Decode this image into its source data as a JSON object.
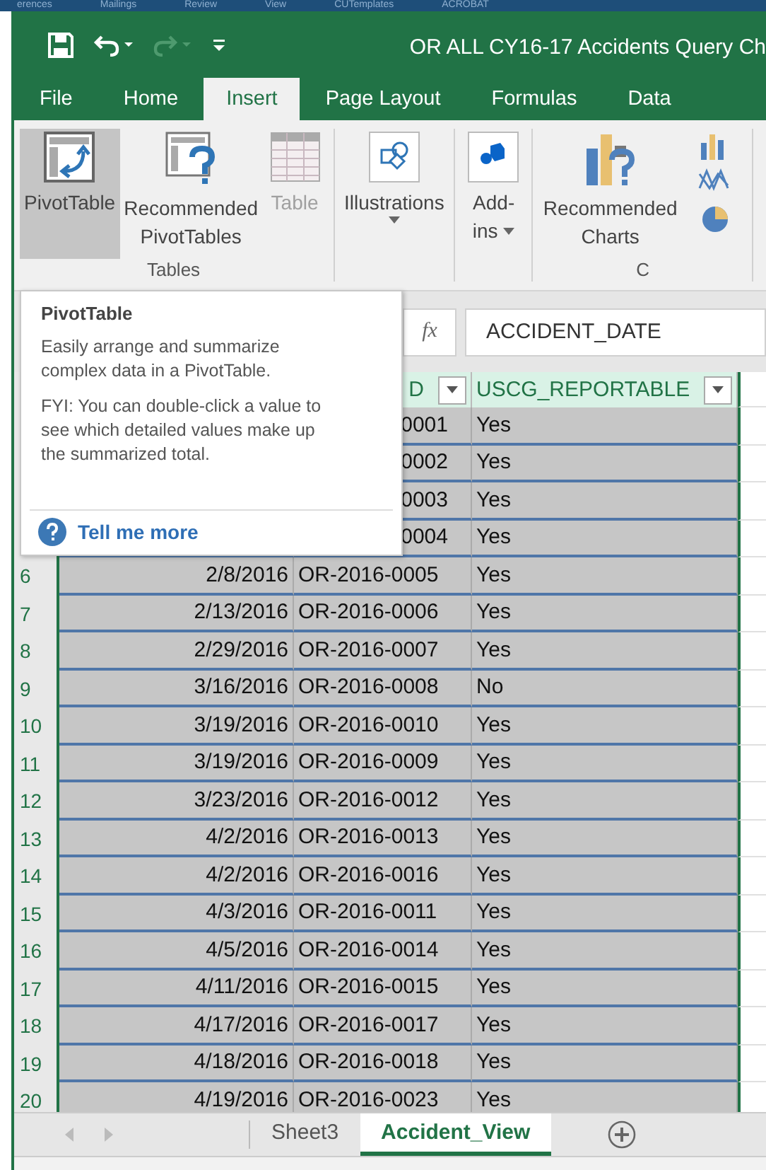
{
  "top_strip": [
    "erences",
    "Mailings",
    "Review",
    "View",
    "CUTemplates",
    "ACROBAT"
  ],
  "title": "OR ALL CY16-17 Accidents Query Ch",
  "tabs": [
    {
      "label": "File",
      "selected": false
    },
    {
      "label": "Home",
      "selected": false
    },
    {
      "label": "Insert",
      "selected": true
    },
    {
      "label": "Page Layout",
      "selected": false
    },
    {
      "label": "Formulas",
      "selected": false
    },
    {
      "label": "Data",
      "selected": false
    }
  ],
  "ribbon_groups": [
    {
      "label": "Tables",
      "items": [
        {
          "kind": "pivot",
          "lines": [
            "PivotTable"
          ],
          "selected": true,
          "disabled": false,
          "dropdown": false
        },
        {
          "kind": "recpivot",
          "lines": [
            "Recommended",
            "PivotTables"
          ],
          "selected": false,
          "disabled": false,
          "dropdown": false
        },
        {
          "kind": "table",
          "lines": [
            "Table"
          ],
          "selected": false,
          "disabled": true,
          "dropdown": false
        }
      ]
    },
    {
      "items": [
        {
          "kind": "illustrations",
          "lines": [
            "Illustrations"
          ],
          "selected": false,
          "disabled": false,
          "dropdown": true
        }
      ]
    },
    {
      "items": [
        {
          "kind": "addins",
          "lines": [
            "Add-",
            "ins"
          ],
          "selected": false,
          "disabled": false,
          "dropdown": true
        }
      ]
    },
    {
      "label": "C",
      "items": [
        {
          "kind": "reccharts",
          "lines": [
            "Recommended",
            "Charts"
          ],
          "selected": false,
          "disabled": false,
          "dropdown": false
        },
        {
          "kind": "charticons",
          "selected": false
        }
      ]
    }
  ],
  "formula_bar": {
    "fx": "fx",
    "value": "ACCIDENT_DATE"
  },
  "header": {
    "col_b": "D",
    "col_c": "USCG_REPORTABLE"
  },
  "rows": [
    {
      "id": "0001",
      "reportable": "Yes"
    },
    {
      "id": "0002",
      "reportable": "Yes"
    },
    {
      "id": "0003",
      "reportable": "Yes"
    },
    {
      "id": "0004",
      "reportable": "Yes"
    },
    {
      "num": "6",
      "date": "2/8/2016",
      "id": "OR-2016-0005",
      "reportable": "Yes"
    },
    {
      "num": "7",
      "date": "2/13/2016",
      "id": "OR-2016-0006",
      "reportable": "Yes"
    },
    {
      "num": "8",
      "date": "2/29/2016",
      "id": "OR-2016-0007",
      "reportable": "Yes"
    },
    {
      "num": "9",
      "date": "3/16/2016",
      "id": "OR-2016-0008",
      "reportable": "No"
    },
    {
      "num": "10",
      "date": "3/19/2016",
      "id": "OR-2016-0010",
      "reportable": "Yes"
    },
    {
      "num": "11",
      "date": "3/19/2016",
      "id": "OR-2016-0009",
      "reportable": "Yes"
    },
    {
      "num": "12",
      "date": "3/23/2016",
      "id": "OR-2016-0012",
      "reportable": "Yes"
    },
    {
      "num": "13",
      "date": "4/2/2016",
      "id": "OR-2016-0013",
      "reportable": "Yes"
    },
    {
      "num": "14",
      "date": "4/2/2016",
      "id": "OR-2016-0016",
      "reportable": "Yes"
    },
    {
      "num": "15",
      "date": "4/3/2016",
      "id": "OR-2016-0011",
      "reportable": "Yes"
    },
    {
      "num": "16",
      "date": "4/5/2016",
      "id": "OR-2016-0014",
      "reportable": "Yes"
    },
    {
      "num": "17",
      "date": "4/11/2016",
      "id": "OR-2016-0015",
      "reportable": "Yes"
    },
    {
      "num": "18",
      "date": "4/17/2016",
      "id": "OR-2016-0017",
      "reportable": "Yes"
    },
    {
      "num": "19",
      "date": "4/18/2016",
      "id": "OR-2016-0018",
      "reportable": "Yes"
    },
    {
      "num": "20",
      "date": "4/19/2016",
      "id": "OR-2016-0023",
      "reportable": "Yes"
    }
  ],
  "tooltip": {
    "title": "PivotTable",
    "paragraphs": [
      "Easily arrange and summarize complex data in a PivotTable.",
      "FYI: You can double-click a value to see which detailed values make up the summarized total."
    ],
    "link": "Tell me more"
  },
  "sheet_tabs": [
    {
      "label": "Sheet3",
      "selected": false
    },
    {
      "label": "Accident_View",
      "selected": true
    }
  ]
}
